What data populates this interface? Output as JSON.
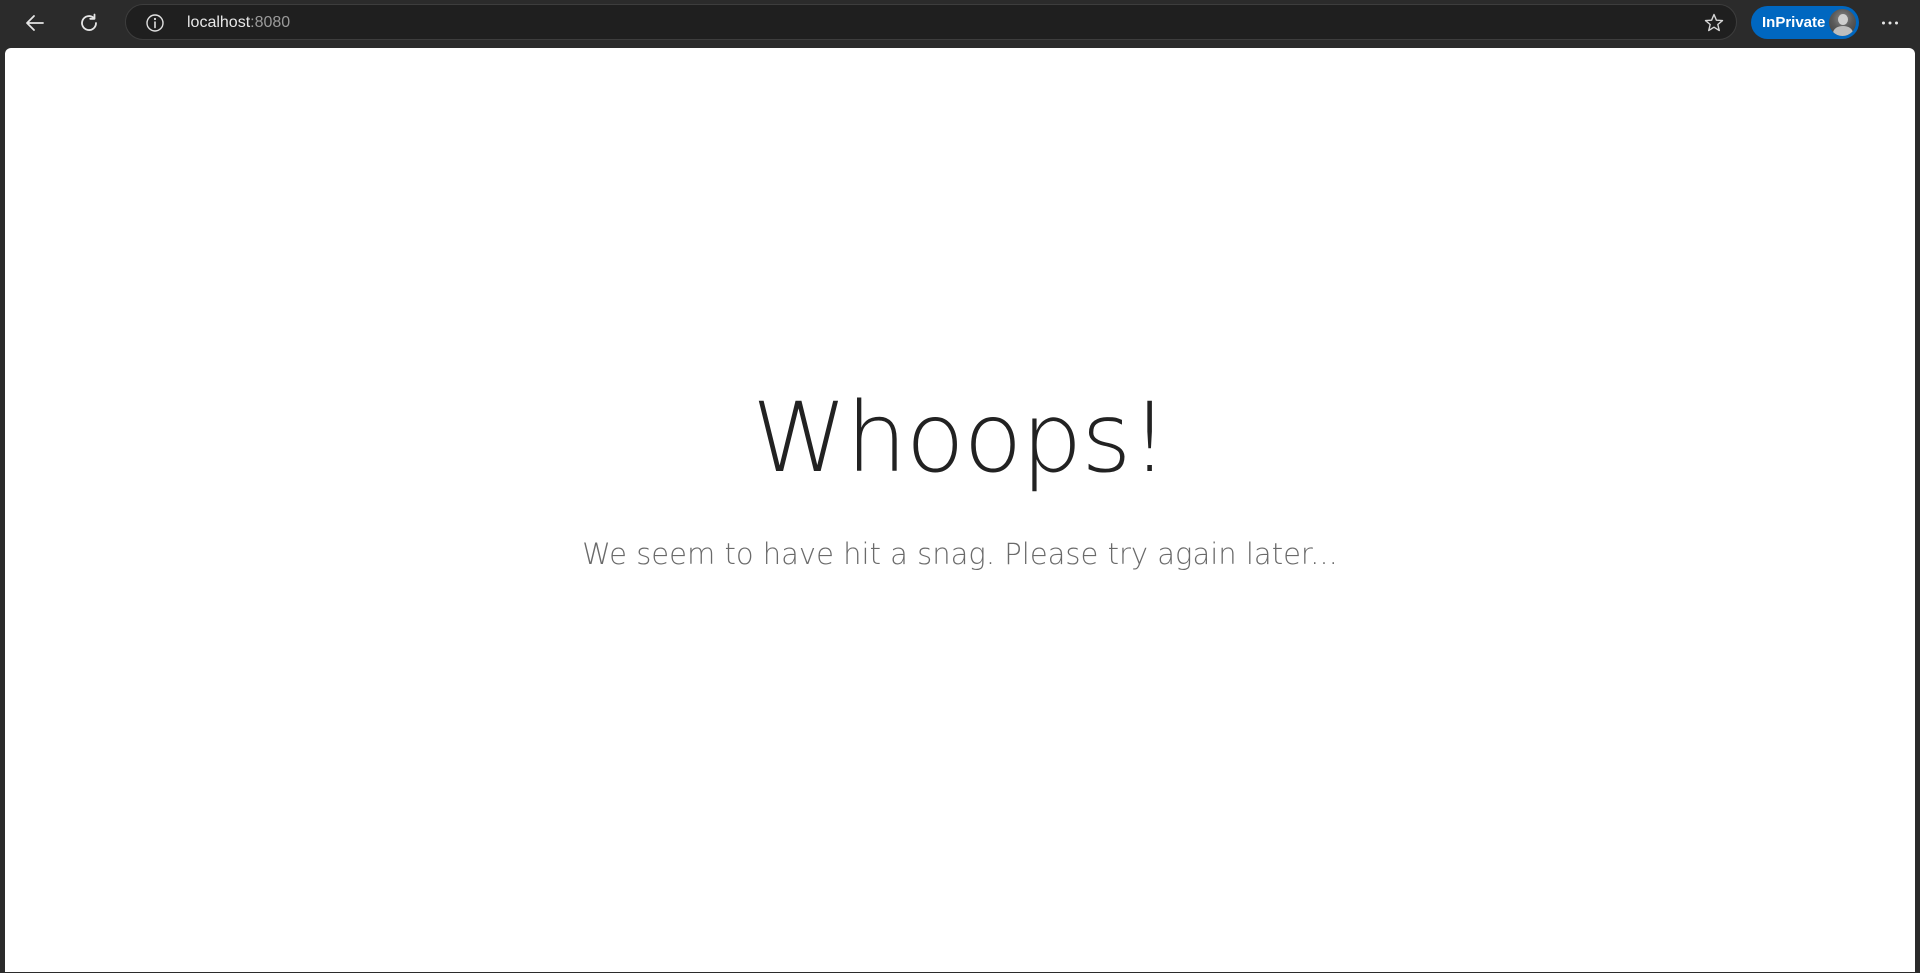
{
  "browser": {
    "address_bar": {
      "host": "localhost",
      "port": ":8080"
    },
    "inprivate_label": "InPrivate",
    "icons": {
      "back": "back-arrow-icon",
      "refresh": "refresh-icon",
      "site_info": "info-icon",
      "favorite": "star-icon",
      "avatar": "profile-avatar",
      "more": "more-horizontal-icon"
    },
    "colors": {
      "chrome": "#2b2b2b",
      "address_bar": "#1f1f1f",
      "inprivate_badge": "#0067c0"
    }
  },
  "page": {
    "heading": "Whoops!",
    "message": "We seem to have hit a snag. Please try again later..."
  }
}
